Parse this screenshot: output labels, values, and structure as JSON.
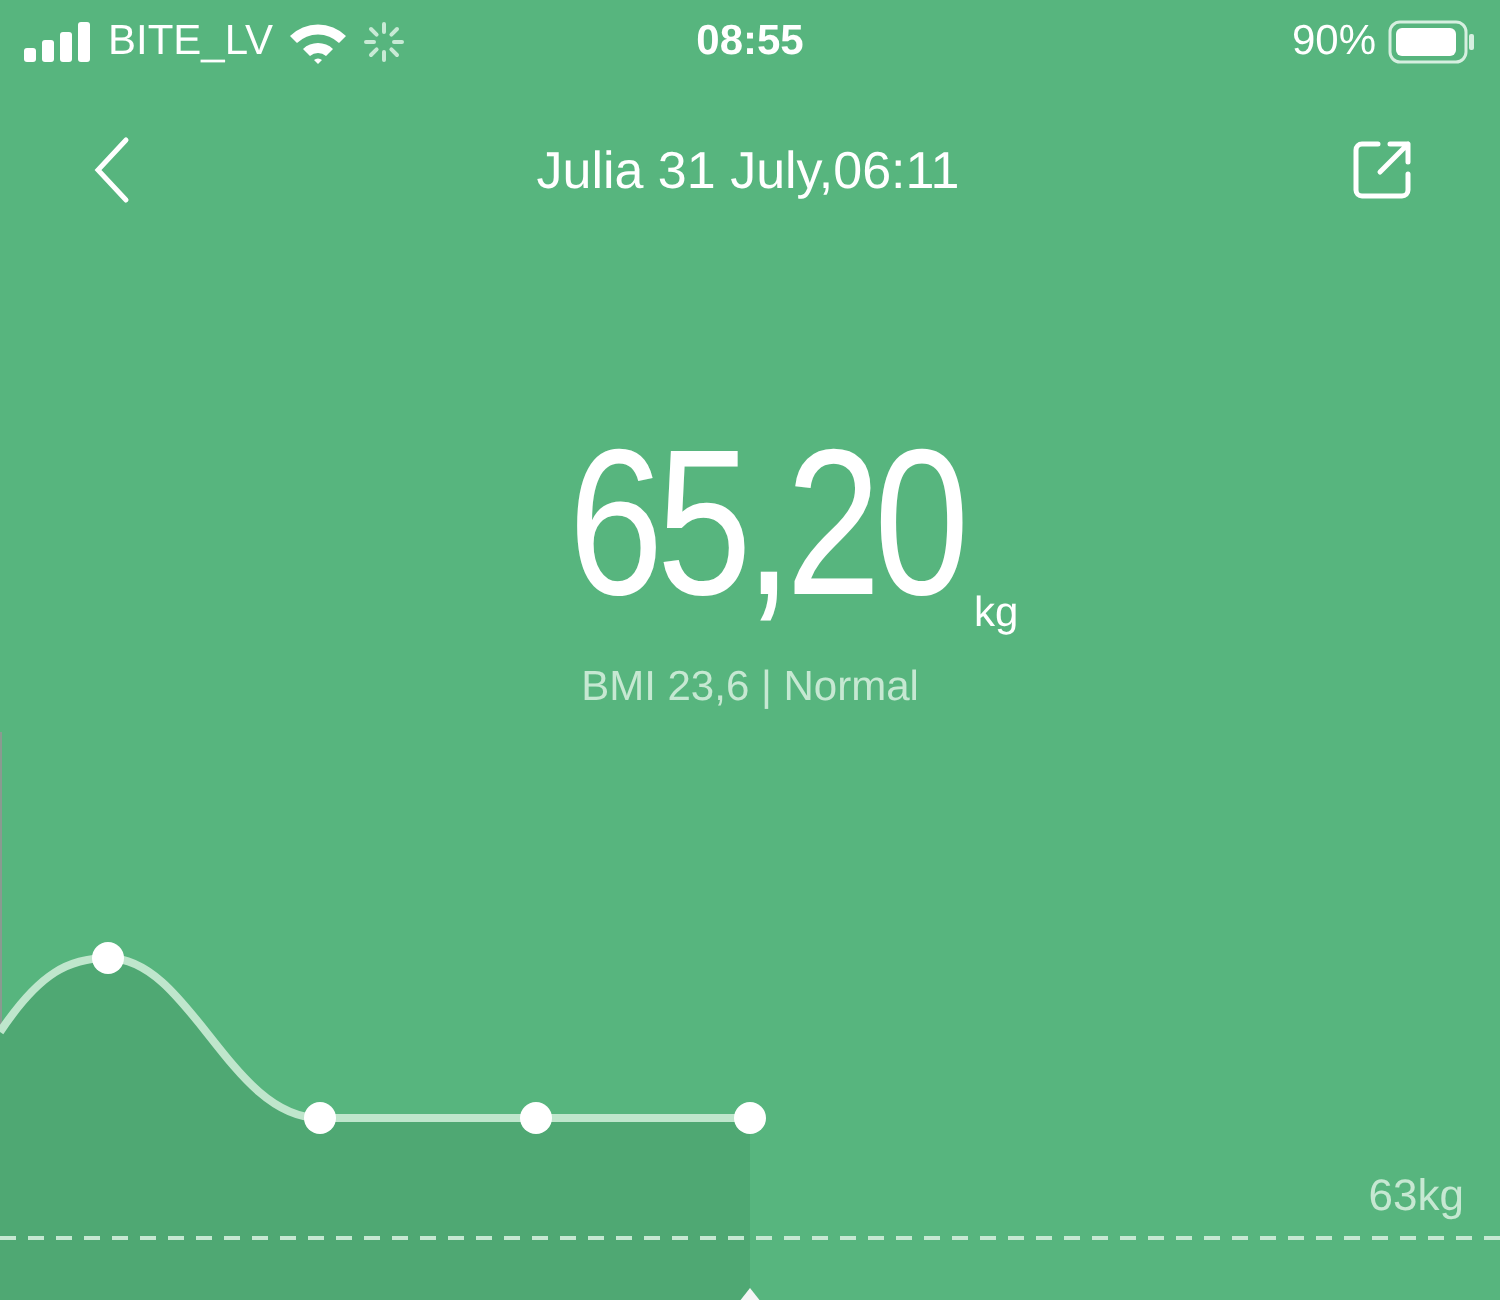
{
  "status_bar": {
    "carrier": "BITE_LV",
    "time": "08:55",
    "battery": "90%"
  },
  "nav": {
    "title": "Julia 31 July,06:11"
  },
  "weight": {
    "value": "65,20",
    "unit": "kg",
    "bmi": "BMI 23,6 | Normal"
  },
  "chart": {
    "reference_label": "63kg"
  }
}
